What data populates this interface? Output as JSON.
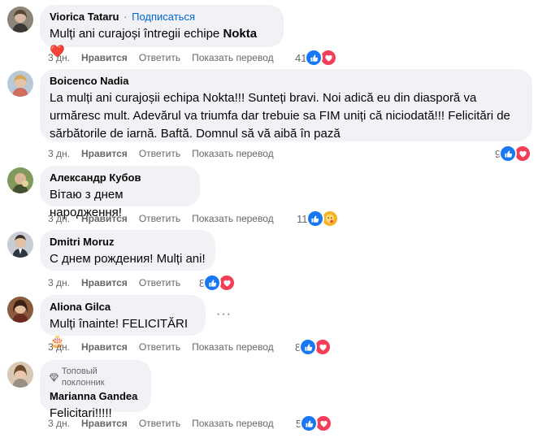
{
  "comments": [
    {
      "author": "Viorica Tataru",
      "separator": "·",
      "subscribe": "Подписаться",
      "text_before": "Mulți ani curajoși întregii echipe ",
      "text_bold": "Nokta",
      "emoji": "❤️",
      "time": "3 дн.",
      "like": "Нравится",
      "reply": "Ответить",
      "translate": "Показать перевод",
      "reaction_count": "41",
      "reactions": [
        "like-icon",
        "love-icon"
      ]
    },
    {
      "author": "Boicenco Nadia",
      "text": "La mulți ani curajoșii echipa Nokta!!! Sunteți bravi. Noi adică eu din diasporă va urmăresc mult. Adevărul va triumfa dar trebuie sa FIM uniți că niciodată!!! Felicitări de sărbătorile de iarnă. Baftă. Domnul să vă aibă în pază",
      "time": "3 дн.",
      "like": "Нравится",
      "reply": "Ответить",
      "translate": "Показать перевод",
      "reaction_count": "9",
      "reactions": [
        "like-icon",
        "love-icon"
      ]
    },
    {
      "author": "Александр Кубов",
      "text": "Вітаю з днем народження!",
      "time": "3 дн.",
      "like": "Нравится",
      "reply": "Ответить",
      "translate": "Показать перевод",
      "reaction_count": "11",
      "reactions": [
        "like-icon",
        "care-icon"
      ]
    },
    {
      "author": "Dmitri Moruz",
      "text": "С днем рождения! Mulți ani!",
      "time": "3 дн.",
      "like": "Нравится",
      "reply": "Ответить",
      "reaction_count": "8",
      "reactions": [
        "like-icon",
        "love-icon"
      ]
    },
    {
      "author": "Aliona Gilca",
      "text": "Mulți înainte! FELICITĂRI ",
      "emoji": "🎂",
      "more": "···",
      "time": "3 дн.",
      "like": "Нравится",
      "reply": "Ответить",
      "translate": "Показать перевод",
      "reaction_count": "8",
      "reactions": [
        "like-icon",
        "love-icon"
      ]
    },
    {
      "badge": "Топовый поклонник",
      "author": "Marianna Gandea",
      "text": "Felicitari!!!!!",
      "time": "3 дн.",
      "like": "Нравится",
      "reply": "Ответить",
      "translate": "Показать перевод",
      "reaction_count": "5",
      "reactions": [
        "like-icon",
        "love-icon"
      ]
    }
  ],
  "colors": {
    "bubble": "#f0f2f5",
    "link": "#0064d1",
    "like": "#1877f2",
    "love": "#f33e58",
    "care": "#f7b125",
    "muted": "#65676b"
  }
}
